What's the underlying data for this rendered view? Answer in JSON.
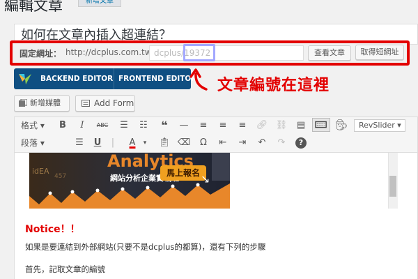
{
  "header": {
    "title": "編輯文章",
    "add_new_label": "新增文章"
  },
  "post": {
    "title": "如何在文章內插入超連結？"
  },
  "permalink": {
    "label": "固定網址：",
    "base_url": "http://dcplus.com.tw/",
    "slug_prefix": "dcplus/",
    "slug_value": "19372",
    "view_button": "查看文章",
    "shortlink_button": "取得短網址"
  },
  "visual_composer": {
    "backend_label": "BACKEND EDITOR",
    "frontend_label": "FRONTEND EDITOR"
  },
  "annotation": {
    "text": "文章編號在這裡",
    "color": "#e30000"
  },
  "media_buttons": {
    "add_media": "新增媒體",
    "add_form": "Add Form"
  },
  "toolbar": {
    "format_select": "格式",
    "paragraph_select": "段落",
    "revslider_label": "RevSlider",
    "buttons": {
      "bold": "B",
      "italic": "I",
      "strike": "ABC",
      "quote": "❝",
      "underline": "U",
      "omega": "Ω",
      "help": "?"
    }
  },
  "banner": {
    "word": "Analytics",
    "subtitle": "網站分析企業實戰班",
    "cta": "馬上報名",
    "cta_arrow": "↘"
  },
  "content": {
    "notice": "Notice！！",
    "paragraph1": "如果是要連結到外部網站(只要不是dcplus的都算)，還有下列的步驟",
    "paragraph2": "首先，記取文章的編號"
  },
  "colors": {
    "accent_red": "#e30000",
    "vc_blue": "#0f4f82",
    "highlight_box": "#a3a8ff"
  }
}
